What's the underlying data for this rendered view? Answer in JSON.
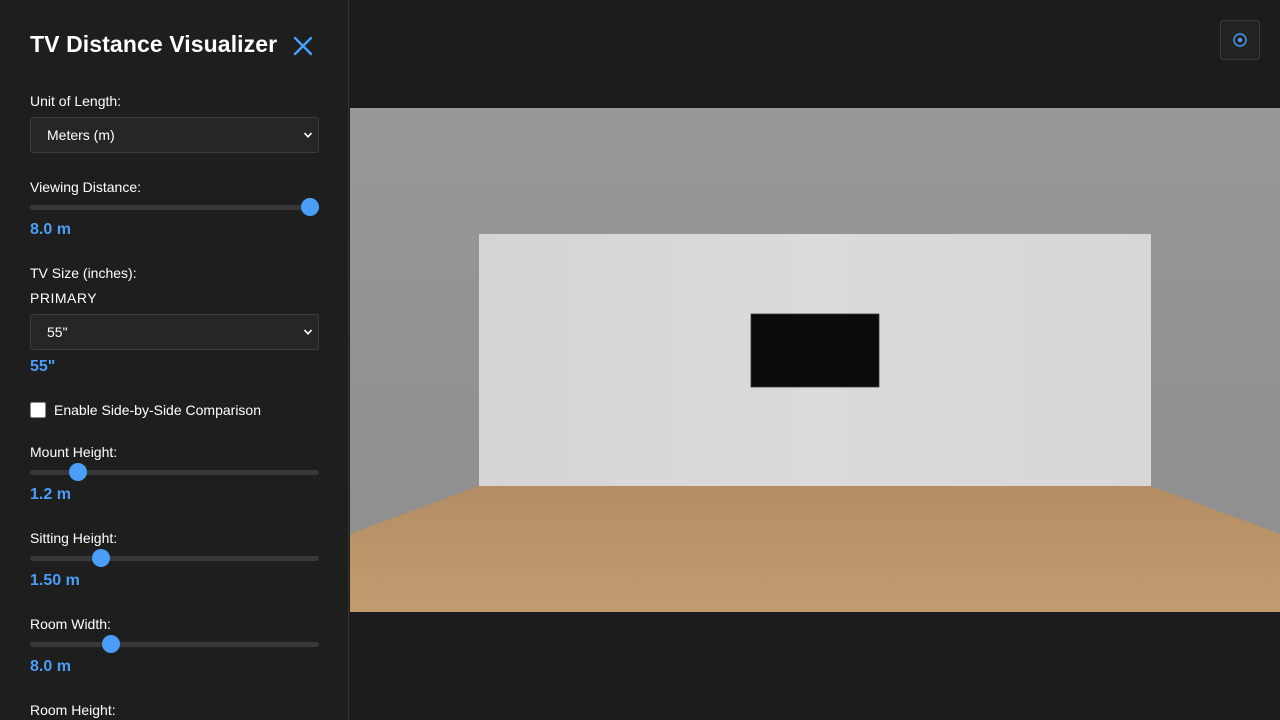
{
  "panel": {
    "title": "TV Distance Visualizer",
    "close_icon": "close-icon",
    "unit": {
      "label": "Unit of Length:",
      "selected": "Meters (m)"
    },
    "viewing_distance": {
      "label": "Viewing Distance:",
      "value_text": "8.0 m",
      "value": 8.0,
      "slider_fraction": 1.0
    },
    "tv_size": {
      "label": "TV Size (inches):",
      "primary_label": "PRIMARY",
      "selected": "55\"",
      "value_text": "55\""
    },
    "comparison": {
      "label": "Enable Side-by-Side Comparison",
      "checked": false
    },
    "mount_height": {
      "label": "Mount Height:",
      "value_text": "1.2 m",
      "value": 1.2,
      "slider_fraction": 0.145
    },
    "sitting_height": {
      "label": "Sitting Height:",
      "value_text": "1.50 m",
      "value": 1.5,
      "slider_fraction": 0.229
    },
    "room_width": {
      "label": "Room Width:",
      "value_text": "8.0 m",
      "value": 8.0,
      "slider_fraction": 0.267
    },
    "room_height": {
      "label": "Room Height:"
    }
  },
  "viewer": {
    "reset_view_icon": "target-icon"
  },
  "colors": {
    "accent": "#4a9ef8",
    "sidebar_bg": "#1e1e1e",
    "page_bg": "#1c1c1c",
    "wall_side": "#949494",
    "back_wall": "#dadad8",
    "floor": "#b8946a",
    "tv_screen": "#0b0b0b"
  }
}
